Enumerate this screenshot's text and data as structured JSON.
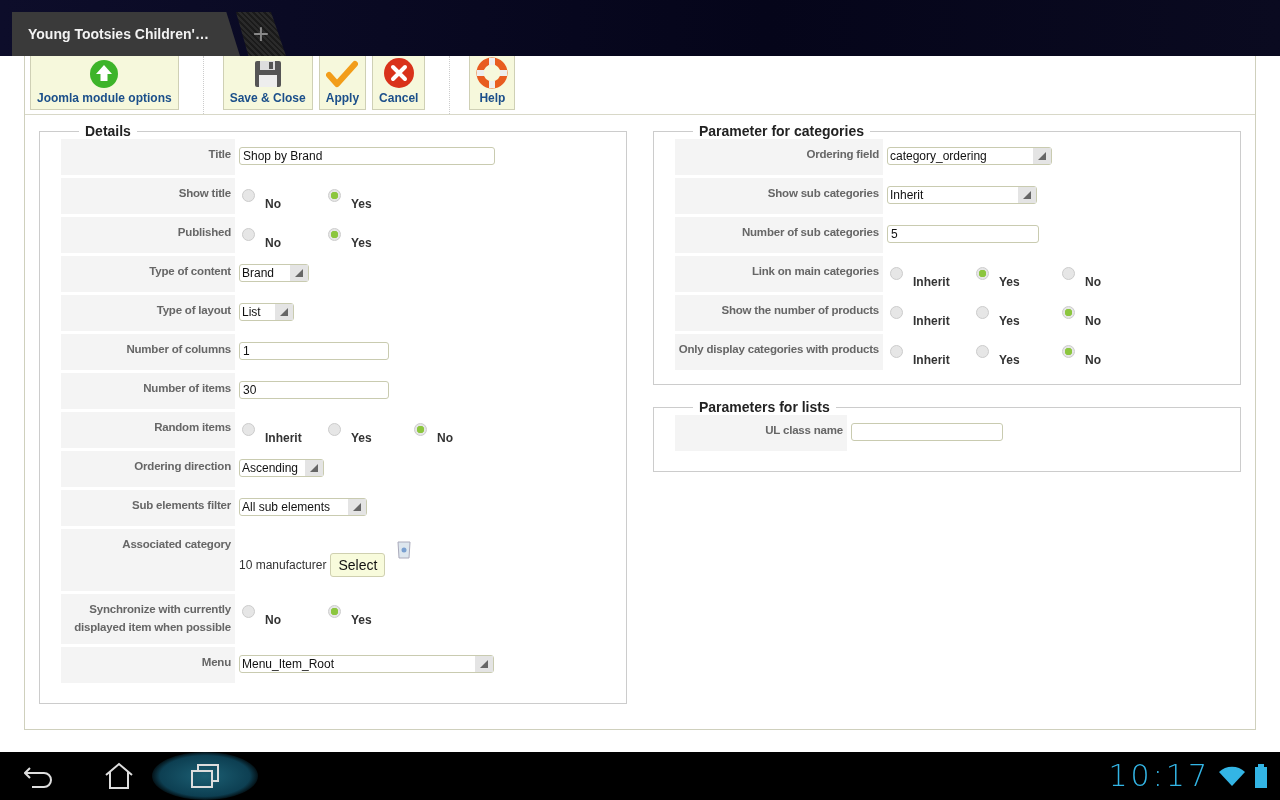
{
  "browser": {
    "tab_title": "Young Tootsies Children'…",
    "new_tab": "+"
  },
  "toolbar": [
    {
      "kind": "module",
      "label": "Joomla module options"
    },
    {
      "kind": "save",
      "label": "Save & Close"
    },
    {
      "kind": "apply",
      "label": "Apply"
    },
    {
      "kind": "cancel",
      "label": "Cancel"
    },
    {
      "kind": "help",
      "label": "Help"
    }
  ],
  "details": {
    "title": "Details",
    "rows": [
      {
        "label": "Title",
        "kind": "text",
        "value": "Shop by Brand"
      },
      {
        "label": "Show title",
        "kind": "radio",
        "options": [
          {
            "label": "No",
            "selected": false
          },
          {
            "label": "Yes",
            "selected": true
          }
        ]
      },
      {
        "label": "Published",
        "kind": "radio",
        "options": [
          {
            "label": "No",
            "selected": false
          },
          {
            "label": "Yes",
            "selected": true
          }
        ]
      },
      {
        "label": "Type of content",
        "kind": "select",
        "value": "Brand"
      },
      {
        "label": "Type of layout",
        "kind": "select",
        "value": "List"
      },
      {
        "label": "Number of columns",
        "kind": "text",
        "value": "1"
      },
      {
        "label": "Number of items",
        "kind": "text",
        "value": "30"
      },
      {
        "label": "Random items",
        "kind": "radio",
        "options": [
          {
            "label": "Inherit",
            "selected": false
          },
          {
            "label": "Yes",
            "selected": false
          },
          {
            "label": "No",
            "selected": true
          }
        ]
      },
      {
        "label": "Ordering direction",
        "kind": "select",
        "value": "Ascending"
      },
      {
        "label": "Sub elements filter",
        "kind": "select",
        "value": "All sub elements"
      },
      {
        "label": "Associated category",
        "kind": "category",
        "value": "10 manufacturer",
        "button": "Select"
      },
      {
        "label": "Synchronize with currently displayed item when possible",
        "kind": "radio",
        "options": [
          {
            "label": "No",
            "selected": false
          },
          {
            "label": "Yes",
            "selected": true
          }
        ]
      },
      {
        "label": "Menu",
        "kind": "select",
        "value": "Menu_Item_Root"
      }
    ]
  },
  "categories": {
    "title": "Parameter for categories",
    "rows": [
      {
        "label": "Ordering field",
        "kind": "select",
        "value": "category_ordering"
      },
      {
        "label": "Show sub categories",
        "kind": "select",
        "value": "Inherit"
      },
      {
        "label": "Number of sub categories",
        "kind": "text",
        "value": "5"
      },
      {
        "label": "Link on main categories",
        "kind": "radio",
        "options": [
          {
            "label": "Inherit",
            "selected": false
          },
          {
            "label": "Yes",
            "selected": true
          },
          {
            "label": "No",
            "selected": false
          }
        ]
      },
      {
        "label": "Show the number of products",
        "kind": "radio",
        "options": [
          {
            "label": "Inherit",
            "selected": false
          },
          {
            "label": "Yes",
            "selected": false
          },
          {
            "label": "No",
            "selected": true
          }
        ]
      },
      {
        "label": "Only display categories with products",
        "kind": "radio",
        "options": [
          {
            "label": "Inherit",
            "selected": false
          },
          {
            "label": "Yes",
            "selected": false
          },
          {
            "label": "No",
            "selected": true
          }
        ]
      }
    ]
  },
  "lists": {
    "title": "Parameters for lists",
    "rows": [
      {
        "label": "UL class name",
        "kind": "text",
        "value": ""
      }
    ]
  },
  "status": {
    "time": "10:17"
  }
}
